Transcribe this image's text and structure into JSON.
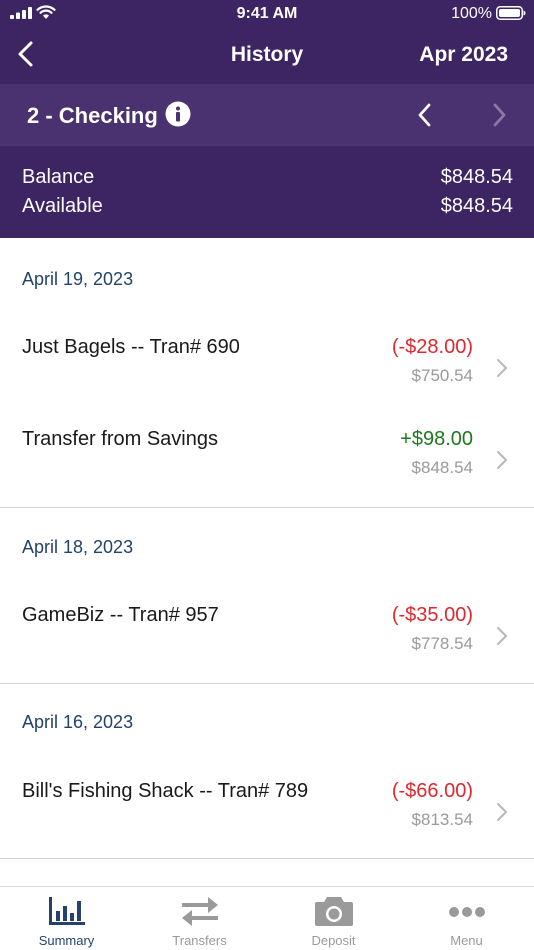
{
  "status_bar": {
    "time": "9:41 AM",
    "battery": "100%"
  },
  "nav": {
    "title": "History",
    "month": "Apr 2023"
  },
  "account": {
    "name": "2 - Checking"
  },
  "balances": [
    {
      "label": "Balance",
      "value": "$848.54"
    },
    {
      "label": "Available",
      "value": "$848.54"
    }
  ],
  "groups": [
    {
      "date": "April 19, 2023",
      "transactions": [
        {
          "name": "Just Bagels -- Tran# 690",
          "amount": "(-$28.00)",
          "running_balance": "$750.54",
          "type": "debit"
        },
        {
          "name": "Transfer from Savings",
          "amount": "+$98.00",
          "running_balance": "$848.54",
          "type": "credit"
        }
      ]
    },
    {
      "date": "April 18, 2023",
      "transactions": [
        {
          "name": "GameBiz -- Tran# 957",
          "amount": "(-$35.00)",
          "running_balance": "$778.54",
          "type": "debit"
        }
      ]
    },
    {
      "date": "April 16, 2023",
      "transactions": [
        {
          "name": "Bill's Fishing Shack -- Tran# 789",
          "amount": "(-$66.00)",
          "running_balance": "$813.54",
          "type": "debit"
        }
      ]
    }
  ],
  "tabs": [
    {
      "label": "Summary",
      "icon": "bar-chart-icon",
      "active": true
    },
    {
      "label": "Transfers",
      "icon": "transfer-arrows-icon",
      "active": false
    },
    {
      "label": "Deposit",
      "icon": "camera-icon",
      "active": false
    },
    {
      "label": "Menu",
      "icon": "more-dots-icon",
      "active": false
    }
  ],
  "colors": {
    "header_bg": "#3d2463",
    "account_bar_bg": "#4a3170",
    "debit": "#e0282e",
    "credit": "#1e7a1e",
    "date_heading": "#24426b",
    "tab_active": "#24426b",
    "tab_inactive": "#9a9a9a"
  }
}
